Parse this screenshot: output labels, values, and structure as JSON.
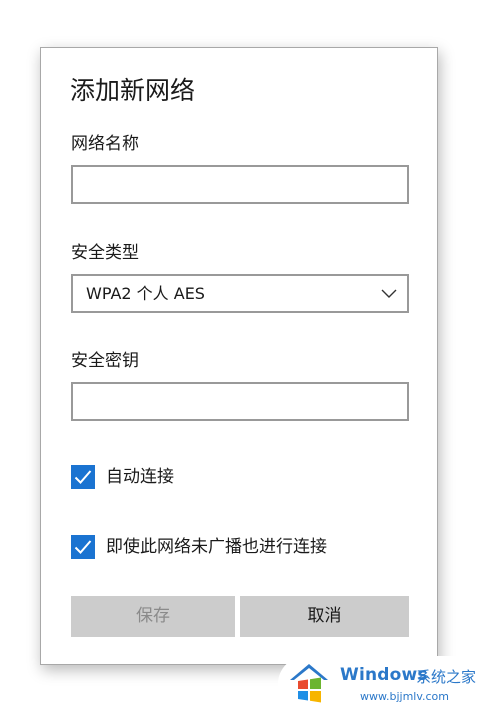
{
  "dialog": {
    "title": "添加新网络",
    "network_name": {
      "label": "网络名称",
      "value": ""
    },
    "security_type": {
      "label": "安全类型",
      "selected": "WPA2 个人 AES"
    },
    "security_key": {
      "label": "安全密钥",
      "value": ""
    },
    "checkboxes": [
      {
        "label": "自动连接",
        "checked": true
      },
      {
        "label": "即使此网络未广播也进行连接",
        "checked": true
      }
    ],
    "buttons": {
      "save": "保存",
      "cancel": "取消"
    }
  },
  "watermark": {
    "brand": "Windows",
    "site_name": "系统之家",
    "url": "www.bjjmlv.com"
  },
  "colors": {
    "checkbox_accent": "#1a73d1",
    "button_bg": "#cccccc",
    "watermark_blue": "#2b78c9"
  }
}
